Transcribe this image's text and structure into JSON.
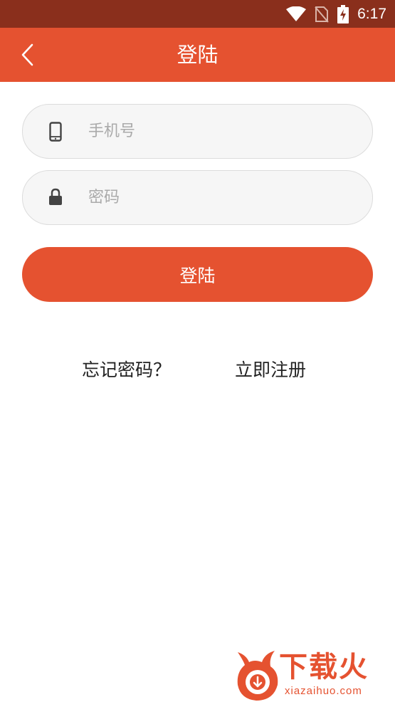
{
  "status_bar": {
    "time": "6:17"
  },
  "header": {
    "title": "登陆",
    "back_icon": "chevron-left-icon"
  },
  "form": {
    "phone": {
      "placeholder": "手机号",
      "value": "",
      "icon": "smartphone-icon"
    },
    "password": {
      "placeholder": "密码",
      "value": "",
      "icon": "lock-icon"
    },
    "submit_label": "登陆"
  },
  "links": {
    "forgot": "忘记密码？",
    "register": "立即注册"
  },
  "watermark": {
    "name": "下载火",
    "url": "xiazaihuo.com"
  },
  "colors": {
    "primary": "#e55230",
    "status_bar": "#8a2f1c",
    "field_bg": "#f6f6f6",
    "field_border": "#dcdcdc"
  }
}
